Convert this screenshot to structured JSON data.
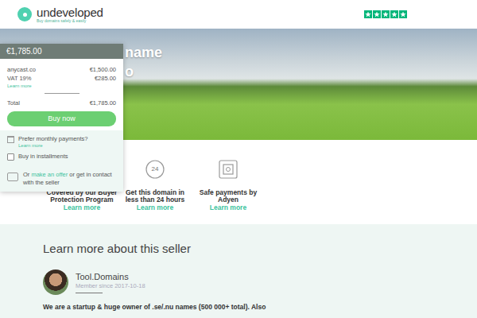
{
  "header": {
    "logo": {
      "name": "undeveloped",
      "tagline": "Buy domains safely & easily"
    },
    "rating": {
      "stars": 5
    }
  },
  "hero": {
    "heading_lines": [
      "name",
      "o"
    ]
  },
  "price_card": {
    "header_price": "€1,785.00",
    "lines": [
      {
        "label": "anycast.co",
        "amount": "€1,500.00"
      },
      {
        "label": "VAT 19%",
        "amount": "€285.00"
      }
    ],
    "vat_link": "Learn more",
    "total_label": "Total",
    "total_amount": "€1,785.00",
    "buy_button": "Buy now",
    "monthly": {
      "label": "Prefer monthly payments?",
      "link": "Learn more"
    },
    "installments": {
      "label": "Buy in installments",
      "checked": false
    },
    "offer": {
      "prefix": "Or",
      "link": "make an offer",
      "suffix": "or get in contact with the seller"
    }
  },
  "features": [
    {
      "kind": "shield",
      "title": "Covered by our Buyer Protection Program",
      "link": "Learn more"
    },
    {
      "kind": "clock",
      "icon_text": "24",
      "title": "Get this domain in less than 24 hours",
      "link": "Learn more"
    },
    {
      "kind": "safe",
      "title": "Safe payments by Adyen",
      "link": "Learn more"
    }
  ],
  "seller": {
    "heading": "Learn more about this seller",
    "name": "Tool.Domains",
    "member_since": "Member since 2017-10-18",
    "description": "We are a startup & huge owner of .se/.nu names (500 000+ total). Also"
  }
}
